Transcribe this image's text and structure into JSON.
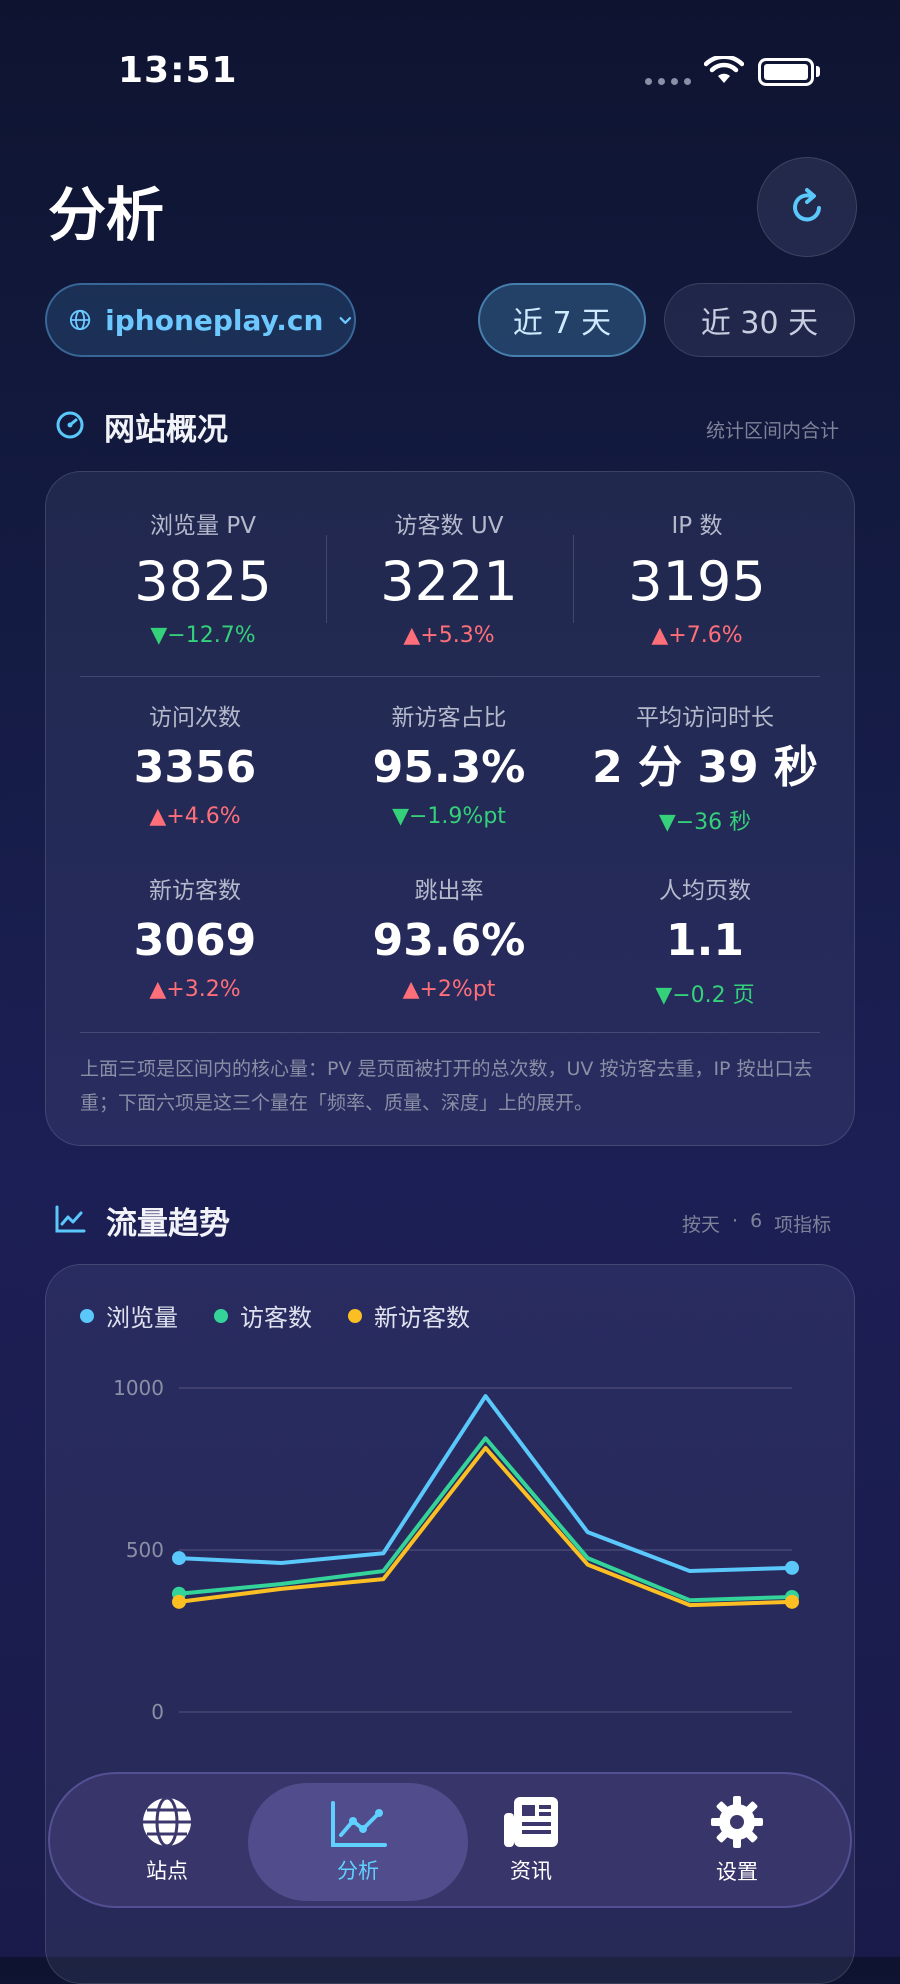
{
  "status": {
    "time": "13:51"
  },
  "header": {
    "title": "分析"
  },
  "site_picker": {
    "domain": "iphoneplay.cn"
  },
  "ranges": {
    "seven": "近 7 天",
    "thirty": "近 30 天",
    "selected": "近 7 天"
  },
  "overview": {
    "title": "网站概况",
    "hint": "统计区间内合计",
    "primary": [
      {
        "label": "浏览量 PV",
        "value": "3825",
        "delta": "−12.7%",
        "dir": "down"
      },
      {
        "label": "访客数 UV",
        "value": "3221",
        "delta": "+5.3%",
        "dir": "up"
      },
      {
        "label": "IP 数",
        "value": "3195",
        "delta": "+7.6%",
        "dir": "up"
      }
    ],
    "secondary": [
      {
        "label": "访问次数",
        "value": "3356",
        "delta": "+4.6%",
        "dir": "up"
      },
      {
        "label": "新访客占比",
        "value": "95.3%",
        "delta": "−1.9%pt",
        "dir": "down"
      },
      {
        "label": "平均访问时长",
        "value": "2 分 39 秒",
        "delta": "−36 秒",
        "dir": "down"
      },
      {
        "label": "新访客数",
        "value": "3069",
        "delta": "+3.2%",
        "dir": "up"
      },
      {
        "label": "跳出率",
        "value": "93.6%",
        "delta": "+2%pt",
        "dir": "up"
      },
      {
        "label": "人均页数",
        "value": "1.1",
        "delta": "−0.2 页",
        "dir": "down"
      }
    ],
    "note": "上面三项是区间内的核心量：PV 是页面被打开的总次数，UV 按访客去重，IP 按出口去重；下面六项是这三个量在「频率、质量、深度」上的展开。"
  },
  "trend": {
    "title": "流量趋势",
    "hint_unit": "按天",
    "hint_sep": "·",
    "hint_count": "6",
    "hint_metrics": "项指标"
  },
  "chart_data": {
    "type": "line",
    "x": [
      1,
      2,
      3,
      4,
      5,
      6,
      7
    ],
    "ylim": [
      0,
      1000
    ],
    "yticks": [
      0,
      500,
      1000
    ],
    "grid": true,
    "legend_position": "top-left",
    "series": [
      {
        "name": "浏览量",
        "color": "#5ac8fa",
        "values": [
          475,
          460,
          490,
          975,
          555,
          435,
          445
        ]
      },
      {
        "name": "访客数",
        "color": "#34d399",
        "values": [
          365,
          395,
          435,
          845,
          475,
          345,
          355
        ]
      },
      {
        "name": "新访客数",
        "color": "#fbbf24",
        "values": [
          340,
          380,
          410,
          815,
          455,
          330,
          340
        ]
      }
    ]
  },
  "tabbar": {
    "items": [
      {
        "label": "站点",
        "icon": "globe-icon"
      },
      {
        "label": "分析",
        "icon": "chart-icon"
      },
      {
        "label": "资讯",
        "icon": "newspaper-icon"
      },
      {
        "label": "设置",
        "icon": "gear-icon"
      }
    ],
    "active": "分析"
  },
  "colors": {
    "accent": "#5fd0ff",
    "up": "#ff6f7a",
    "down": "#34d17a"
  }
}
